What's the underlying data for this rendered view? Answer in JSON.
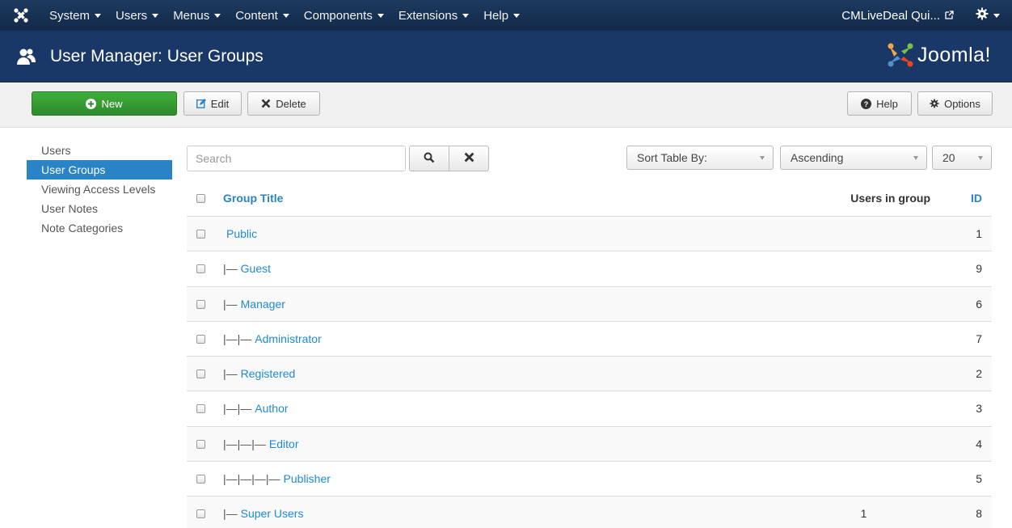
{
  "navbar": {
    "menus": [
      "System",
      "Users",
      "Menus",
      "Content",
      "Components",
      "Extensions",
      "Help"
    ],
    "site_name": "CMLiveDeal Qui..."
  },
  "titlebar": {
    "title": "User Manager: User Groups",
    "brand": "Joomla!"
  },
  "toolbar": {
    "new_label": "New",
    "edit_label": "Edit",
    "delete_label": "Delete",
    "help_label": "Help",
    "options_label": "Options"
  },
  "sidebar": {
    "items": [
      {
        "label": "Users",
        "active": false
      },
      {
        "label": "User Groups",
        "active": true
      },
      {
        "label": "Viewing Access Levels",
        "active": false
      },
      {
        "label": "User Notes",
        "active": false
      },
      {
        "label": "Note Categories",
        "active": false
      }
    ]
  },
  "filters": {
    "search_placeholder": "Search",
    "sort_by": "Sort Table By:",
    "order": "Ascending",
    "limit": "20"
  },
  "table": {
    "headers": {
      "title": "Group Title",
      "users": "Users in group",
      "id": "ID"
    },
    "rows": [
      {
        "prefix": "",
        "title": "Public",
        "users": "",
        "id": "1"
      },
      {
        "prefix": "|—",
        "title": "Guest",
        "users": "",
        "id": "9"
      },
      {
        "prefix": "|—",
        "title": "Manager",
        "users": "",
        "id": "6"
      },
      {
        "prefix": "|—|—",
        "title": "Administrator",
        "users": "",
        "id": "7"
      },
      {
        "prefix": "|—",
        "title": "Registered",
        "users": "",
        "id": "2"
      },
      {
        "prefix": "|—|—",
        "title": "Author",
        "users": "",
        "id": "3"
      },
      {
        "prefix": "|—|—|—",
        "title": "Editor",
        "users": "",
        "id": "4"
      },
      {
        "prefix": "|—|—|—|—",
        "title": "Publisher",
        "users": "",
        "id": "5"
      },
      {
        "prefix": "|—",
        "title": "Super Users",
        "users": "1",
        "id": "8"
      }
    ]
  },
  "colors": {
    "navbar": "#1c3a5e",
    "titlebar": "#1a3867",
    "accent": "#2a83c6",
    "new_button": "#3fae3b"
  }
}
